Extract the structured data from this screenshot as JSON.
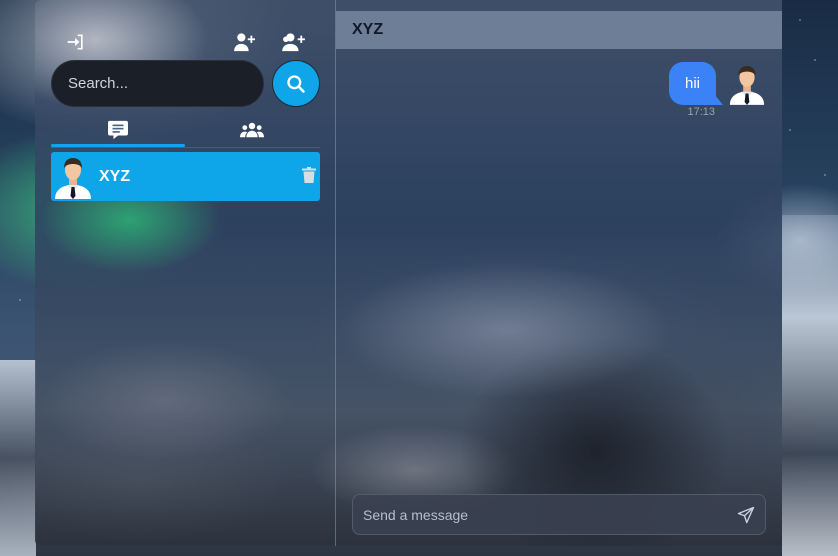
{
  "sidebar": {
    "icons": {
      "logout": "logout-icon",
      "add_user": "user-plus-icon",
      "add_group": "users-plus-icon",
      "search": "search-icon",
      "chats_tab": "chat-message-icon",
      "groups_tab": "users-group-icon",
      "delete": "trash-icon"
    },
    "search": {
      "placeholder": "Search...",
      "value": ""
    },
    "tabs": [
      {
        "label": "chats",
        "active": true
      },
      {
        "label": "groups",
        "active": false
      }
    ],
    "contacts": [
      {
        "name": "XYZ",
        "selected": true
      }
    ]
  },
  "chat": {
    "header": {
      "title": "XYZ"
    },
    "messages": [
      {
        "text": "hii",
        "time": "17:13",
        "sender": "me"
      }
    ],
    "composer": {
      "placeholder": "Send a message",
      "value": ""
    }
  },
  "colors": {
    "accent": "#0ea5e9",
    "bubble": "#3b82f6",
    "search_bg": "#1b1f28",
    "header_bg": "#7887a0"
  }
}
